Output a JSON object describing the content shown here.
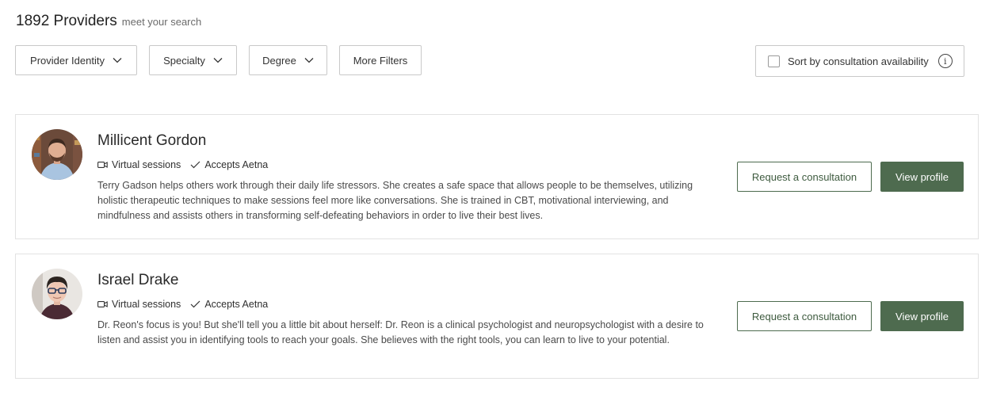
{
  "header": {
    "count": "1892 Providers",
    "subtitle": "meet your search"
  },
  "filters": {
    "provider_identity": "Provider Identity",
    "specialty": "Specialty",
    "degree": "Degree",
    "more_filters": "More Filters"
  },
  "sort": {
    "label": "Sort by consultation availability",
    "checked": false,
    "icon": "info-icon"
  },
  "providers": [
    {
      "name": "Millicent Gordon",
      "tag_virtual": "Virtual sessions",
      "tag_insurance": "Accepts Aetna",
      "description": "Terry Gadson helps others work through their daily life stressors. She creates a safe space that allows people to be themselves, utilizing holistic therapeutic techniques to make sessions feel more like conversations. She is trained in CBT, motivational interviewing, and mindfulness and assists others in transforming self-defeating behaviors in order to live their best lives.",
      "request_label": "Request a consultation",
      "view_label": "View profile"
    },
    {
      "name": "Israel Drake",
      "tag_virtual": "Virtual sessions",
      "tag_insurance": "Accepts Aetna",
      "description": "Dr. Reon's focus is you! But she'll tell you a little bit about herself: Dr. Reon is a clinical psychologist and neuropsychologist with a desire to listen and assist you in identifying tools to reach your goals. She believes with the right tools, you can learn to live to your potential.",
      "request_label": "Request a consultation",
      "view_label": "View profile"
    }
  ],
  "colors": {
    "accent": "#4e6b4f",
    "border": "#c9c9c9"
  }
}
